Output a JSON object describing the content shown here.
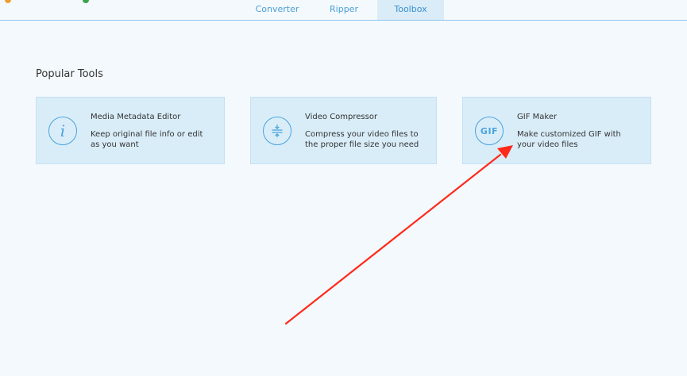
{
  "tabs": [
    {
      "label": "Converter",
      "active": false
    },
    {
      "label": "Ripper",
      "active": false
    },
    {
      "label": "Toolbox",
      "active": true
    }
  ],
  "section_title": "Popular Tools",
  "tools": [
    {
      "title": "Media Metadata Editor",
      "desc": "Keep original file info or edit as you want",
      "icon": "info-icon"
    },
    {
      "title": "Video Compressor",
      "desc": "Compress your video files to the proper file size you need",
      "icon": "compress-icon"
    },
    {
      "title": "GIF Maker",
      "desc": "Make customized GIF with your video files",
      "icon": "gif-icon",
      "icon_text": "GIF"
    }
  ],
  "colors": {
    "accent": "#4aa3dc",
    "background": "#f3f9fd",
    "card": "#d9edf9",
    "annotation_arrow": "#ff2a1a"
  }
}
